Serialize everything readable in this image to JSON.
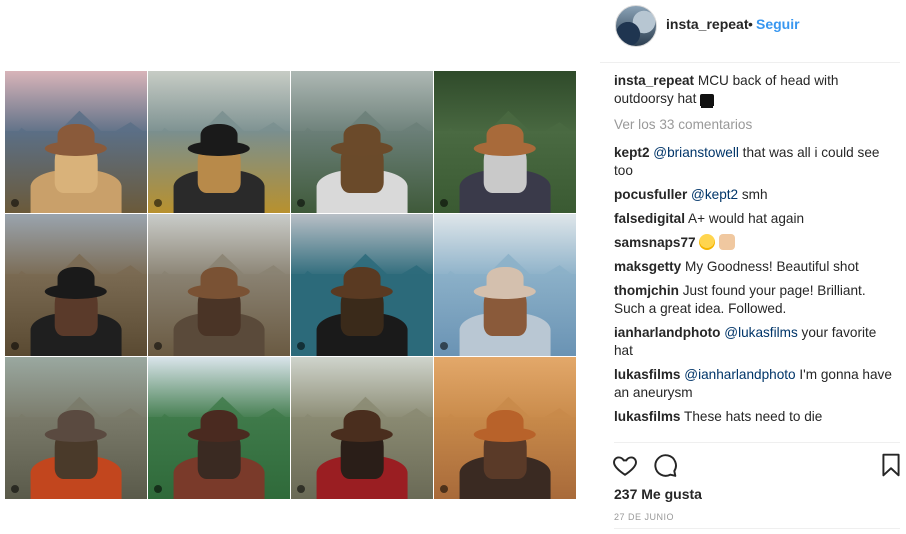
{
  "header": {
    "username": "insta_repeat",
    "separator": "•",
    "follow_label": "Seguir"
  },
  "caption": {
    "username": "insta_repeat",
    "text": "MCU back of head with outdoorsy hat",
    "emoji_icon": "top-hat-icon"
  },
  "view_all_comments": "Ver los 33 comentarios",
  "comments": [
    {
      "user": "kept2",
      "mention": "@brianstowell",
      "text": " that was all i could see too"
    },
    {
      "user": "pocusfuller",
      "mention": "@kept2",
      "text": " smh"
    },
    {
      "user": "falsedigital",
      "mention": "",
      "text": "A+ would hat again"
    },
    {
      "user": "samsnaps77",
      "mention": "",
      "text": "",
      "emoji_icons": [
        "laughing-face-icon",
        "hands-icon"
      ]
    },
    {
      "user": "maksgetty",
      "mention": "",
      "text": "My Goodness! Beautiful shot"
    },
    {
      "user": "thomjchin",
      "mention": "",
      "text": "Just found your page! Brilliant. Such a great idea. Followed."
    },
    {
      "user": "ianharlandphoto",
      "mention": "@lukasfilms",
      "text": " your favorite hat"
    },
    {
      "user": "lukasfilms",
      "mention": "@ianharlandphoto",
      "text": " I'm gonna have an aneurysm"
    },
    {
      "user": "lukasfilms",
      "mention": "",
      "text": "These hats need to die"
    }
  ],
  "actions": {
    "like_icon": "heart-icon",
    "comment_icon": "comment-bubble-icon",
    "save_icon": "bookmark-icon"
  },
  "likes": "237 Me gusta",
  "date": "27 DE JUNIO",
  "tiles": [
    {
      "sky": "#d8b4b9",
      "land": "#6b5a3a",
      "water": "#5b6f86",
      "hat": "#8a5a3a",
      "hair": "#d9b27a",
      "body": "#c9a06a"
    },
    {
      "sky": "#c7ccc5",
      "land": "#b8912e",
      "water": "#7a8f8f",
      "hat": "#1a1a1a",
      "hair": "#b88a4a",
      "body": "#2a2a2a"
    },
    {
      "sky": "#aeb8b4",
      "land": "#3f5a3a",
      "water": "#6b7f78",
      "hat": "#6b4a2a",
      "hair": "#6a4a2a",
      "body": "#d9d9d9"
    },
    {
      "sky": "#2f4a2a",
      "land": "#3a5a32",
      "water": "#4a6a42",
      "hat": "#a86a3a",
      "hair": "#c9c9c9",
      "body": "#3a3a4a"
    },
    {
      "sky": "#9aa4ae",
      "land": "#5a4a32",
      "water": "#7a6a52",
      "hat": "#1a1a1a",
      "hair": "#5a3a2a",
      "body": "#1f1f1f"
    },
    {
      "sky": "#c9ccc9",
      "land": "#6a5a42",
      "water": "#8a8272",
      "hat": "#7a5234",
      "hair": "#4a3426",
      "body": "#5a4a3a"
    },
    {
      "sky": "#b8bfc6",
      "land": "#2c6a7a",
      "water": "#2c6a7a",
      "hat": "#5a3a22",
      "hair": "#3a2a1a",
      "body": "#1a1a1a"
    },
    {
      "sky": "#dfe6ea",
      "land": "#6a93b4",
      "water": "#8bb0c8",
      "hat": "#d4c0ae",
      "hair": "#8a5a3a",
      "body": "#b9c7d3"
    },
    {
      "sky": "#9aa8a0",
      "land": "#5a5a4a",
      "water": "#7a7a6a",
      "hat": "#5a4a40",
      "hair": "#4a3a2a",
      "body": "#c2461e"
    },
    {
      "sky": "#d9e4ea",
      "land": "#2f6a3a",
      "water": "#3f7a4a",
      "hat": "#4a2a20",
      "hair": "#3a2a22",
      "body": "#7a3a2a"
    },
    {
      "sky": "#cfd4cc",
      "land": "#6a6a56",
      "water": "#8a8a72",
      "hat": "#4a2e1e",
      "hair": "#2a1e18",
      "body": "#9a1e22"
    },
    {
      "sky": "#e3a86a",
      "land": "#a86a3a",
      "water": "#c88a4a",
      "hat": "#b8622a",
      "hair": "#5a3a28",
      "body": "#3a2a22"
    }
  ]
}
